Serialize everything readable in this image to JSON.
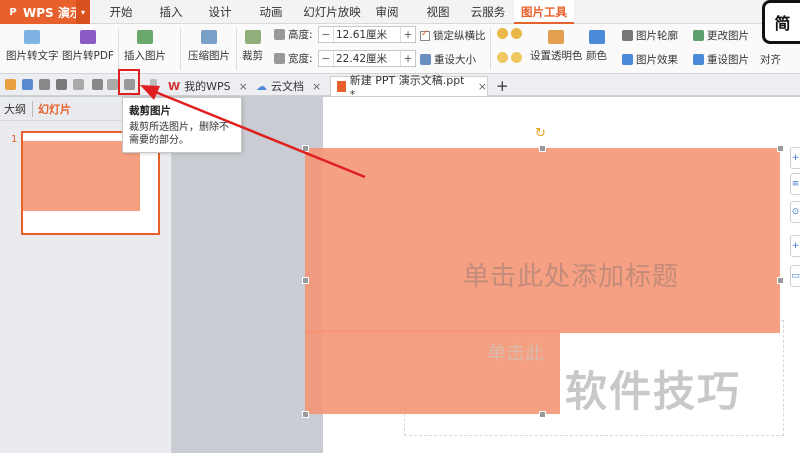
{
  "app": {
    "name": "WPS 演示",
    "logo_glyph": "P",
    "caret": "▾"
  },
  "menu_tabs": [
    {
      "label": "开始"
    },
    {
      "label": "插入"
    },
    {
      "label": "设计"
    },
    {
      "label": "动画"
    },
    {
      "label": "幻灯片放映"
    },
    {
      "label": "审阅"
    },
    {
      "label": "视图"
    },
    {
      "label": "云服务"
    },
    {
      "label": "图片工具"
    }
  ],
  "corner_logo": "简",
  "ribbon": {
    "pic_to_text": "图片转文字",
    "pic_to_pdf": "图片转PDF",
    "insert_picture": "插入图片",
    "compress_picture": "压缩图片",
    "crop": "裁剪",
    "height_label": "高度:",
    "height_value": "12.61厘米",
    "width_label": "宽度:",
    "width_value": "22.42厘米",
    "lock_ratio": "锁定纵横比",
    "reset_size": "重设大小",
    "set_transparent": "设置透明色",
    "color": "颜色",
    "picture_outline": "图片轮廓",
    "picture_effect": "图片效果",
    "change_picture": "更改图片",
    "reset_picture": "重设图片",
    "align": "对齐",
    "minus": "−",
    "plus": "+"
  },
  "doc_tabs": [
    {
      "label": "我的WPS",
      "close": "×"
    },
    {
      "label": "云文档",
      "close": "×"
    },
    {
      "label": "新建 PPT 演示文稿.ppt *",
      "close": "×"
    }
  ],
  "new_tab": "+",
  "tooltip": {
    "title": "裁剪图片",
    "body": "裁剪所选图片，删除不需要的部分。"
  },
  "left_panel": {
    "tab_outline": "大纲",
    "tab_slides": "幻灯片",
    "slide_number": "1"
  },
  "slide": {
    "title_placeholder": "单击此处添加标题",
    "subtitle_placeholder": "单击此",
    "rotate_glyph": "↻"
  },
  "watermark": "软件技巧",
  "side_tools": [
    "+",
    "≡",
    "⊙",
    "+",
    "▭"
  ],
  "colors": {
    "accent": "#e8612c",
    "picture": "#f49676",
    "highlight": "#e02020"
  }
}
